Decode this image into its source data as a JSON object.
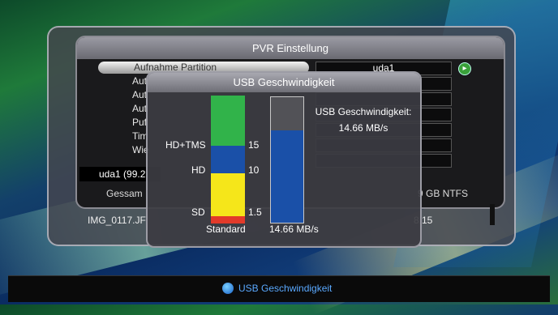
{
  "pvr": {
    "title": "PVR Einstellung",
    "menu_items": [
      "Aufnahme Partition",
      "Aut",
      "Aut",
      "Aut",
      "Puf",
      "Tim",
      "Wie"
    ],
    "partition_value": "uda1",
    "partition_info": "uda1 (99.2",
    "gesamt_label": "Gessam",
    "fs_info": "9 GB  NTFS",
    "file_name": "IMG_0117.JF",
    "file_right": "8.15"
  },
  "usb": {
    "title": "USB Geschwindigkeit",
    "scale_labels": {
      "hd_tms": "HD+TMS",
      "hd": "HD",
      "sd": "SD",
      "standard": "Standard"
    },
    "scale_values": {
      "v15": "15",
      "v10": "10",
      "v15b": "1.5"
    },
    "info_label": "USB Geschwindigkeit:",
    "info_value": "14.66 MB/s",
    "speed_label": "14.66 MB/s",
    "speed_mb_s": 14.66,
    "bar_max_mb_s": 20
  },
  "footer": {
    "label": "USB Geschwindigkeit"
  },
  "colors": {
    "green": "#31b34a",
    "blue": "#1a50a8",
    "yellow": "#f5e61a",
    "red": "#e23a2a"
  }
}
